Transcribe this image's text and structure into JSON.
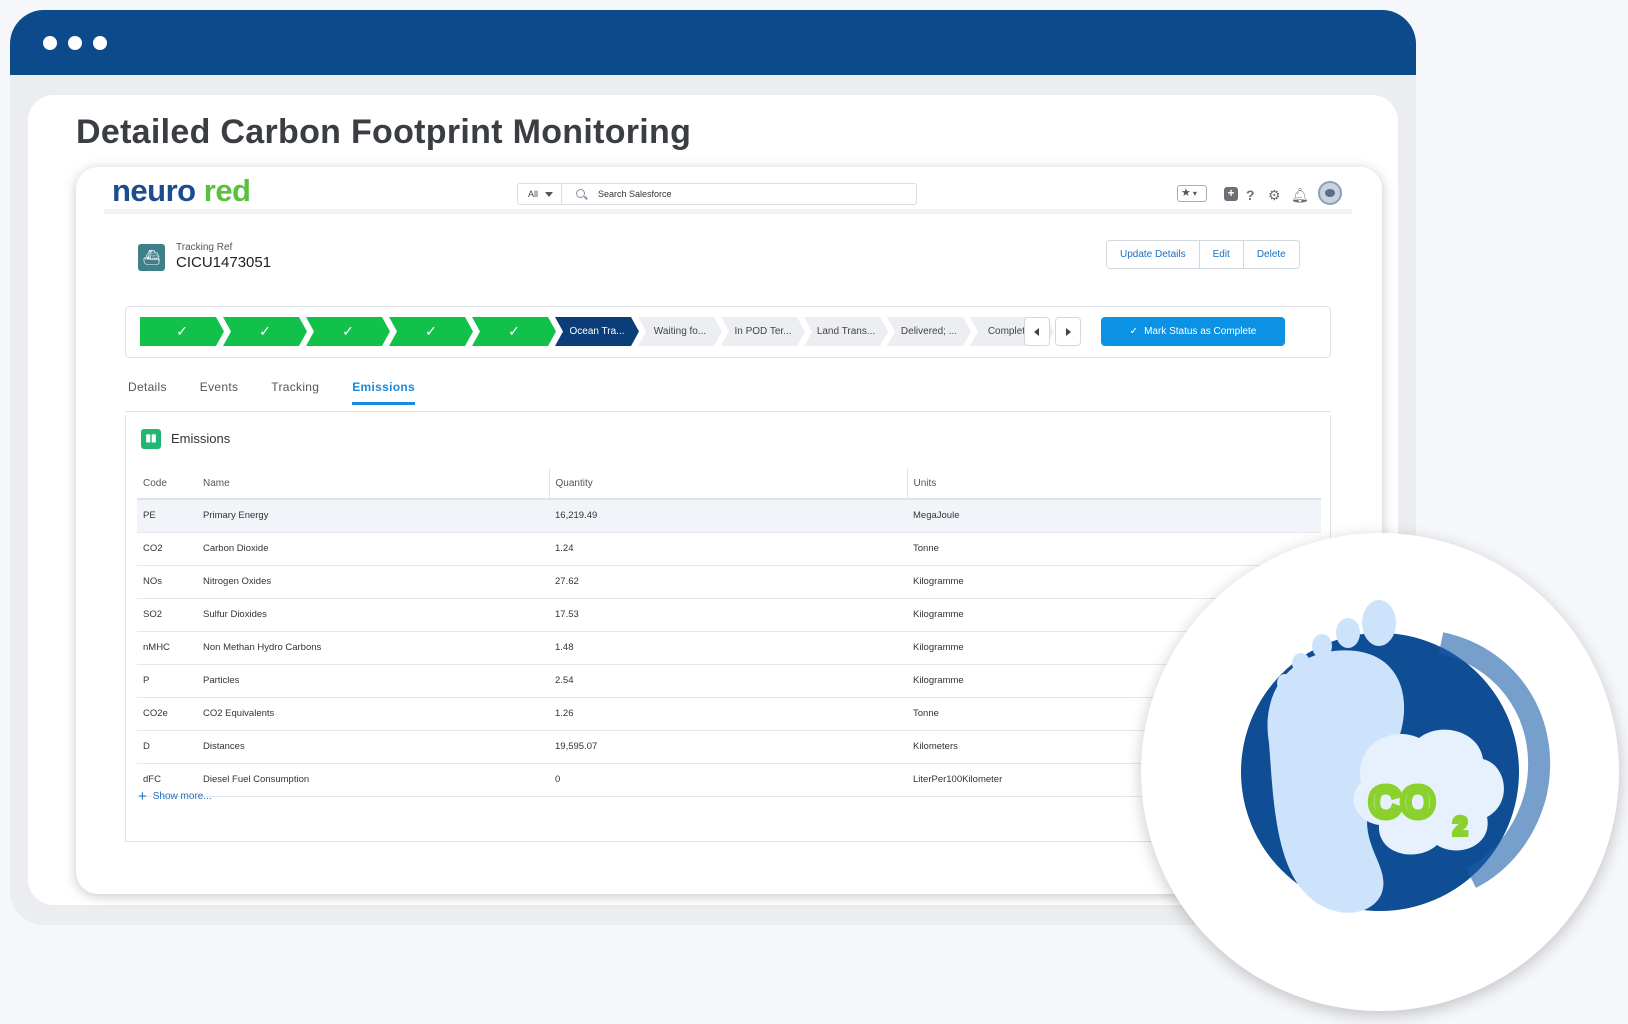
{
  "page": {
    "headline": "Detailed Carbon Footprint Monitoring"
  },
  "app": {
    "logo_part1": "neuro",
    "logo_part2": "red",
    "search": {
      "scope": "All",
      "placeholder": "Search Salesforce"
    }
  },
  "record": {
    "label": "Tracking Ref",
    "value": "CICU1473051",
    "actions": [
      "Update Details",
      "Edit",
      "Delete"
    ]
  },
  "path": {
    "completed_steps": [
      "✓",
      "✓",
      "✓",
      "✓",
      "✓"
    ],
    "current_step": "Ocean Tra...",
    "pending_steps": [
      "Waiting fo...",
      "In POD Ter...",
      "Land Trans...",
      "Delivered; ...",
      "Completed"
    ],
    "mark_button": "Mark Status as Complete"
  },
  "tabs": [
    "Details",
    "Events",
    "Tracking",
    "Emissions"
  ],
  "active_tab": "Emissions",
  "emissions": {
    "title": "Emissions",
    "columns": [
      "Code",
      "Name",
      "Quantity",
      "Units"
    ],
    "rows": [
      [
        "PE",
        "Primary Energy",
        "16,219.49",
        "MegaJoule"
      ],
      [
        "CO2",
        "Carbon Dioxide",
        "1.24",
        "Tonne"
      ],
      [
        "NOs",
        "Nitrogen Oxides",
        "27.62",
        "Kilogramme"
      ],
      [
        "SO2",
        "Sulfur Dioxides",
        "17.53",
        "Kilogramme"
      ],
      [
        "nMHC",
        "Non Methan Hydro Carbons",
        "1.48",
        "Kilogramme"
      ],
      [
        "P",
        "Particles",
        "2.54",
        "Kilogramme"
      ],
      [
        "CO2e",
        "CO2 Equivalents",
        "1.26",
        "Tonne"
      ],
      [
        "D",
        "Distances",
        "19,595.07",
        "Kilometers"
      ],
      [
        "dFC",
        "Diesel Fuel Consumption",
        "0",
        "LiterPer100Kilometer"
      ]
    ],
    "show_more": "Show more..."
  },
  "badge": {
    "icon": "co2-footprint-icon",
    "text_main": "CO",
    "text_sub": "2"
  },
  "colors": {
    "frame_bar": "#0d4a8c",
    "path_done": "#12c14a",
    "path_current": "#0b3e78",
    "primary_button": "#0b92e4",
    "link": "#1a6fc4"
  }
}
